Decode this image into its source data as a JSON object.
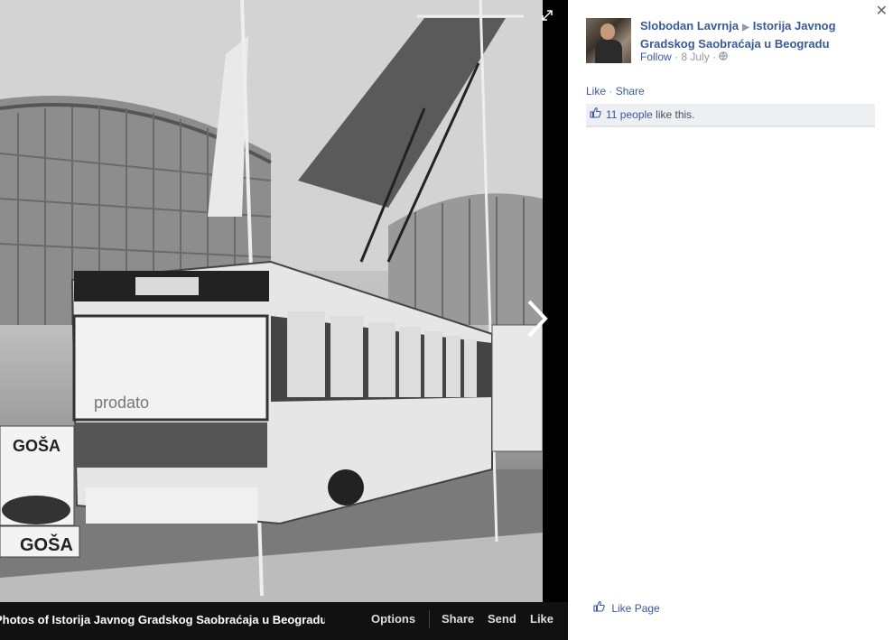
{
  "photo": {
    "alt_signs": [
      "GOŠA",
      "GOŠA",
      "prodato"
    ],
    "bottom_bar": {
      "caption": "Photos of Istorija Javnog Gradskog Saobraćaja u Beogradu",
      "options_label": "Options",
      "share_label": "Share",
      "send_label": "Send",
      "like_label": "Like"
    }
  },
  "panel": {
    "poster_name": "Slobodan Lavrnja",
    "page_name": "Istorija Javnog Gradskog Saobraćaja u Beogradu",
    "follow_label": "Follow",
    "date": "8 July",
    "like_action": "Like",
    "share_action": "Share",
    "likes_count": "11 people",
    "likes_suffix": "like this.",
    "like_page_label": "Like Page"
  },
  "icons": [
    "expand-icon",
    "next-arrow-icon",
    "close-icon",
    "globe-icon",
    "thumbs-up-icon"
  ],
  "colors": {
    "link": "#3b5998",
    "muted": "#9197a3",
    "bar": "#111111"
  }
}
